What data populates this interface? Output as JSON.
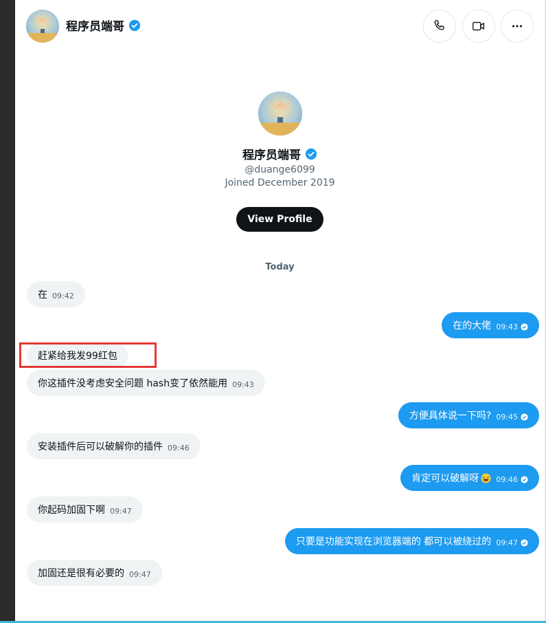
{
  "header": {
    "name": "程序员端哥",
    "verified": true,
    "buttons": [
      {
        "icon": "phone-icon"
      },
      {
        "icon": "video-icon"
      },
      {
        "icon": "more-icon"
      }
    ]
  },
  "profile": {
    "name": "程序员端哥",
    "handle": "@duange6099",
    "joined": "Joined December 2019",
    "view_profile_label": "View Profile"
  },
  "date_separator": "Today",
  "messages": [
    {
      "side": "in",
      "text": "在",
      "time": "09:42"
    },
    {
      "side": "out",
      "text": "在的大佬",
      "time": "09:43"
    },
    {
      "side": "in",
      "text": "赶紧给我发99红包",
      "time": ""
    },
    {
      "side": "in",
      "text": "你这插件没考虑安全问题 hash变了依然能用",
      "time": "09:43"
    },
    {
      "side": "out",
      "text": "方便具体说一下吗?",
      "time": "09:45"
    },
    {
      "side": "in",
      "text": "安装插件后可以破解你的插件",
      "time": "09:46"
    },
    {
      "side": "out",
      "text": "肯定可以破解呀",
      "time": "09:46",
      "emoji": "laughing-emoji-icon"
    },
    {
      "side": "in",
      "text": "你起码加固下啊",
      "time": "09:47"
    },
    {
      "side": "out",
      "text": "只要是功能实现在浏览器端的 都可以被绕过的",
      "time": "09:47"
    },
    {
      "side": "in",
      "text": "加固还是很有必要的",
      "time": "09:47"
    }
  ],
  "colors": {
    "accent": "#1d9bf0",
    "incoming_bubble": "#eff3f4",
    "highlight_box": "#e53935",
    "dark_button": "#0f1419"
  }
}
